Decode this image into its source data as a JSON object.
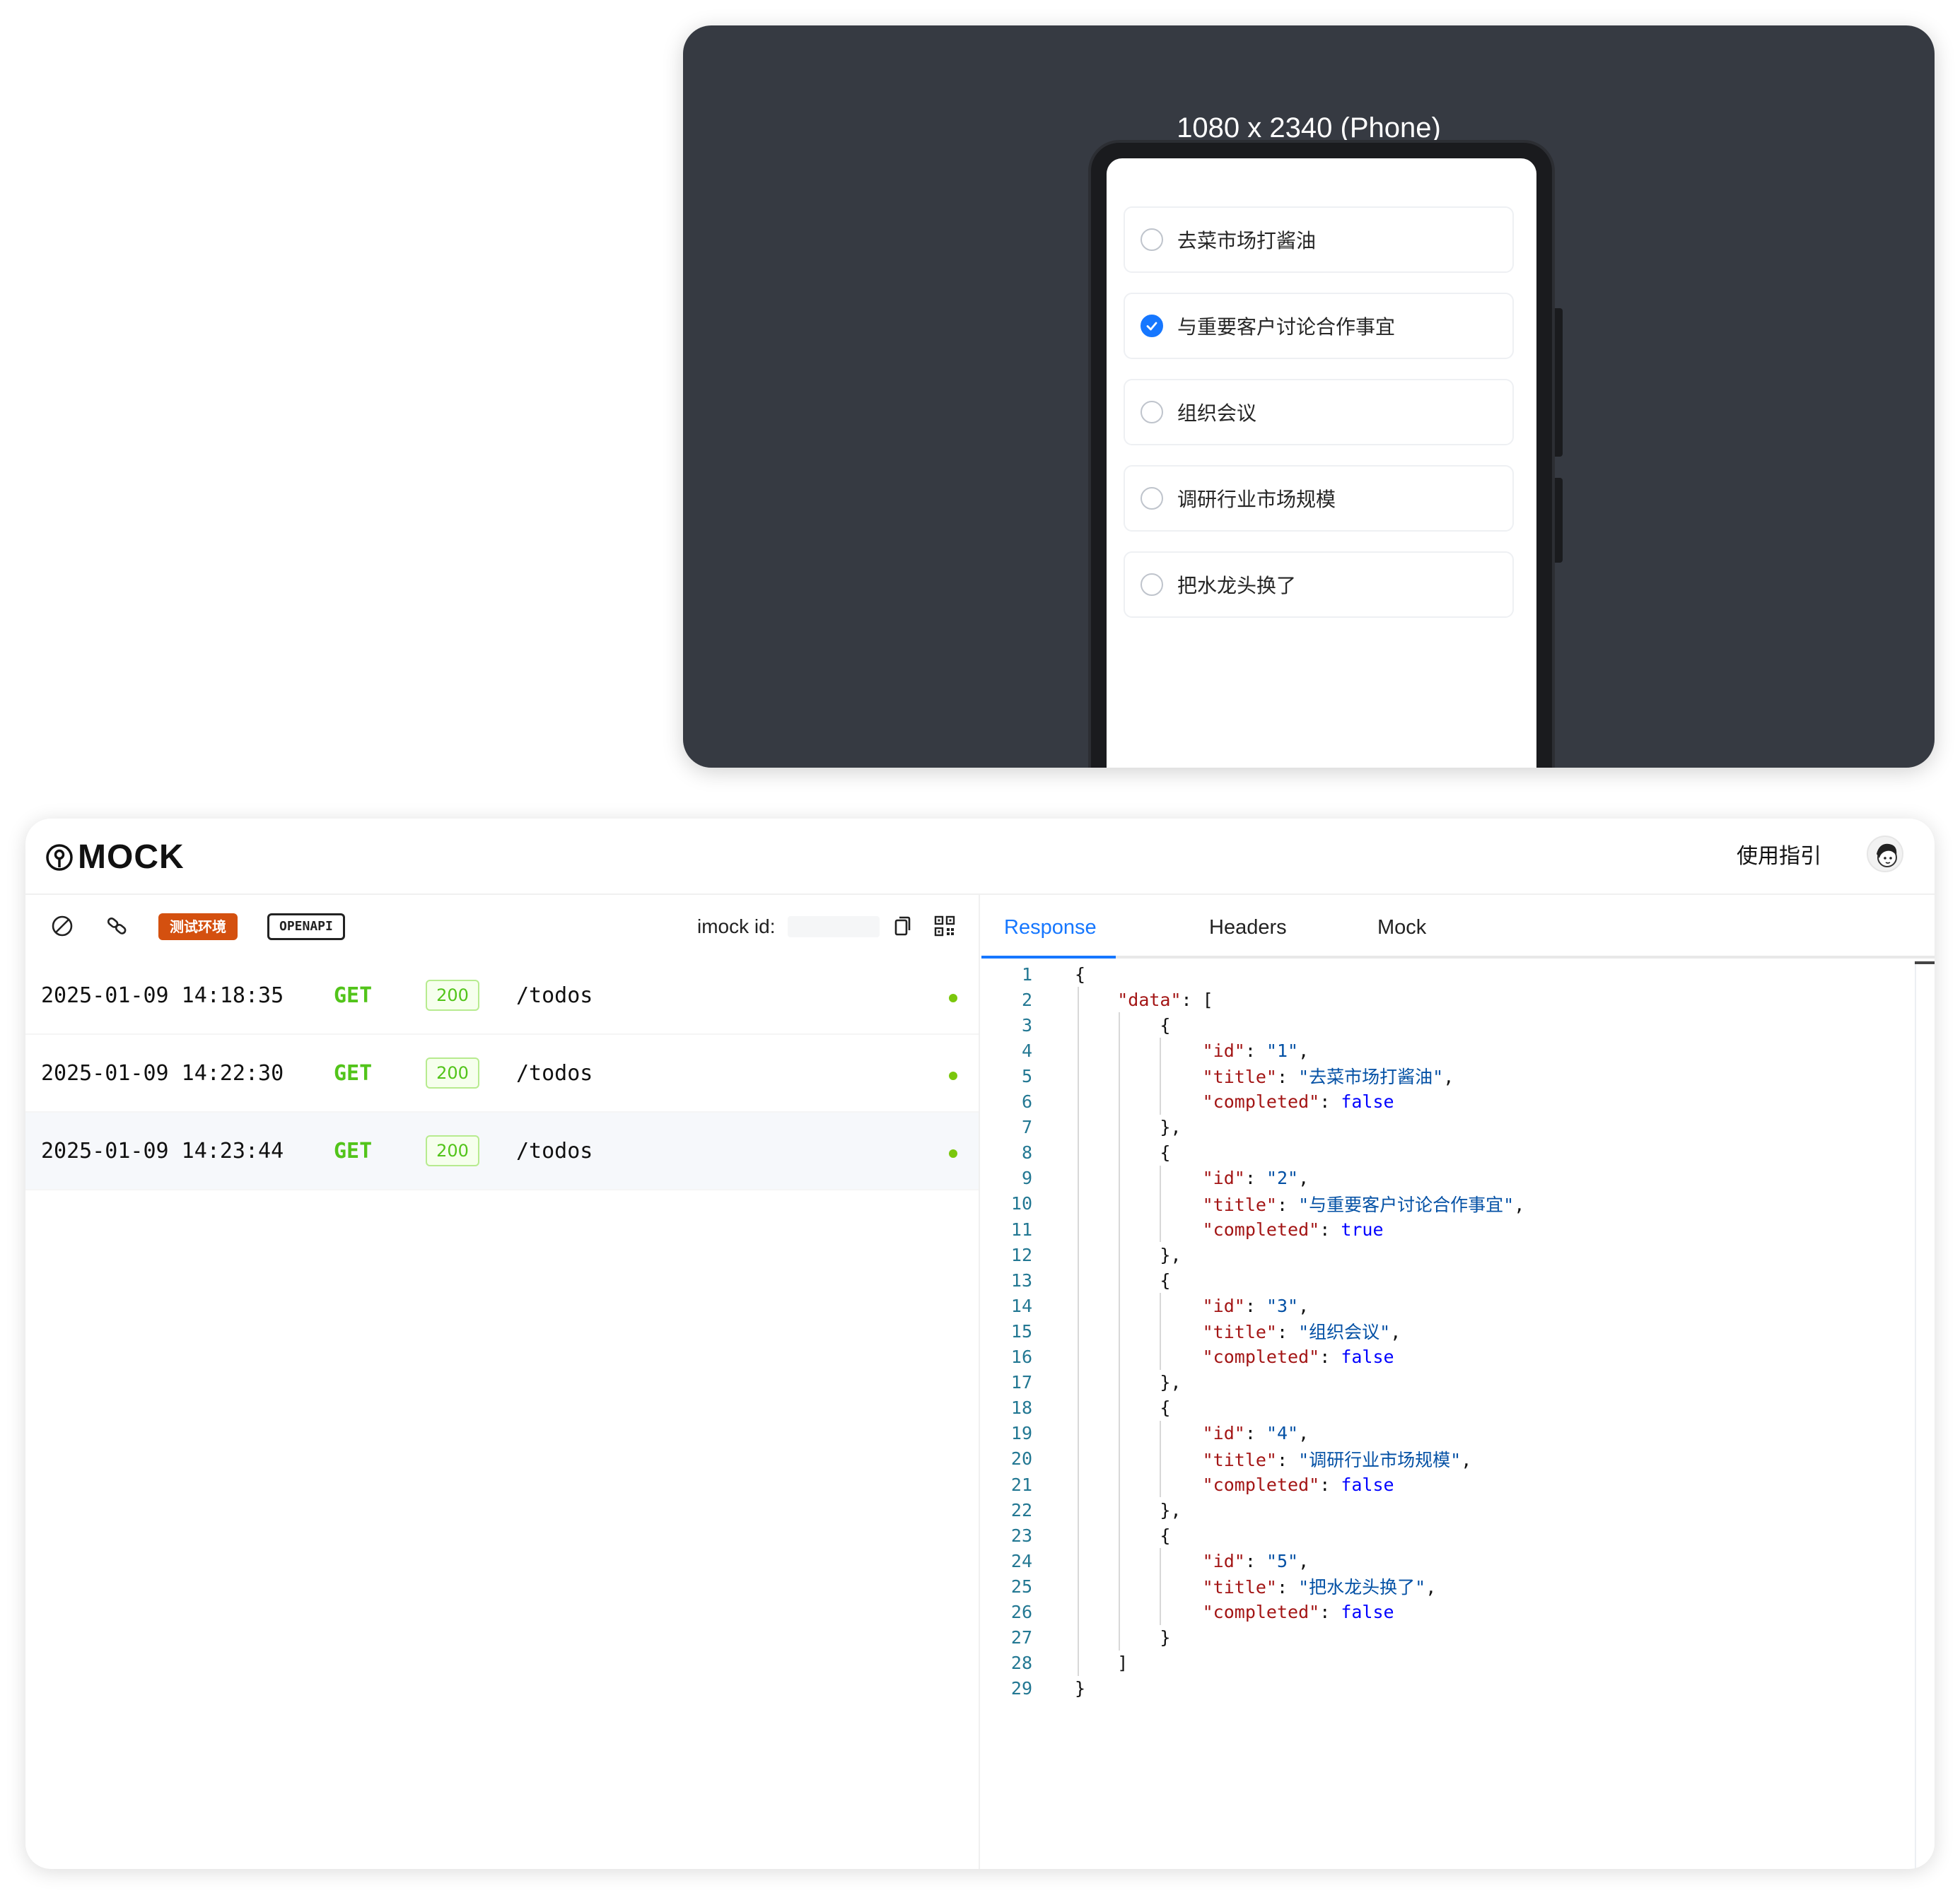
{
  "preview": {
    "device_label": "1080 x 2340 (Phone)",
    "todos": [
      {
        "title": "去菜市场打酱油",
        "completed": false
      },
      {
        "title": "与重要客户讨论合作事宜",
        "completed": true
      },
      {
        "title": "组织会议",
        "completed": false
      },
      {
        "title": "调研行业市场规模",
        "completed": false
      },
      {
        "title": "把水龙头换了",
        "completed": false
      }
    ]
  },
  "header": {
    "logo_text": "MOCK",
    "guide_label": "使用指引"
  },
  "toolbar": {
    "env_label": "测试环境",
    "openapi_label": "OPENAPI",
    "imock_label": "imock id:"
  },
  "requests": [
    {
      "time": "2025-01-09 14:18:35",
      "method": "GET",
      "status": "200",
      "path": "/todos",
      "active": false
    },
    {
      "time": "2025-01-09 14:22:30",
      "method": "GET",
      "status": "200",
      "path": "/todos",
      "active": false
    },
    {
      "time": "2025-01-09 14:23:44",
      "method": "GET",
      "status": "200",
      "path": "/todos",
      "active": true
    }
  ],
  "tabs": [
    "Response",
    "Headers",
    "Mock"
  ],
  "active_tab": "Response",
  "response_lines": [
    "{",
    "    \"data\": [",
    "        {",
    "            \"id\": \"1\",",
    "            \"title\": \"去菜市场打酱油\",",
    "            \"completed\": false",
    "        },",
    "        {",
    "            \"id\": \"2\",",
    "            \"title\": \"与重要客户讨论合作事宜\",",
    "            \"completed\": true",
    "        },",
    "        {",
    "            \"id\": \"3\",",
    "            \"title\": \"组织会议\",",
    "            \"completed\": false",
    "        },",
    "        {",
    "            \"id\": \"4\",",
    "            \"title\": \"调研行业市场规模\",",
    "            \"completed\": false",
    "        },",
    "        {",
    "            \"id\": \"5\",",
    "            \"title\": \"把水龙头换了\",",
    "            \"completed\": false",
    "        }",
    "    ]",
    "}"
  ],
  "colors": {
    "accent": "#1677ff",
    "env_badge": "#d4500f",
    "method_get": "#52c41a",
    "preview_bg": "#363a42"
  }
}
